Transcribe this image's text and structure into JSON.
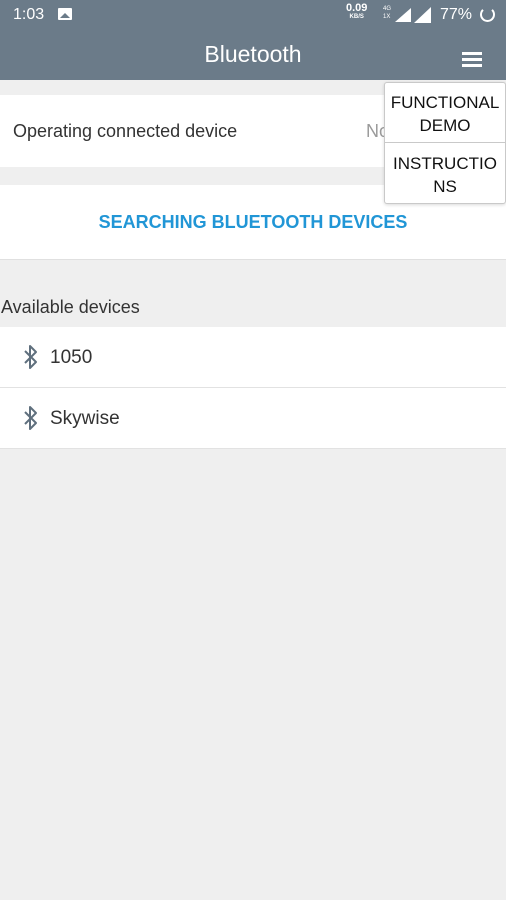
{
  "status_bar": {
    "time": "1:03",
    "net_speed": "0.09",
    "net_speed_unit": "KB/S",
    "network_label_top": "4G",
    "network_label_bottom": "1X",
    "battery": "77%"
  },
  "app_bar": {
    "title": "Bluetooth"
  },
  "connected": {
    "label": "Operating connected device",
    "value": "No"
  },
  "search_button": "SEARCHING BLUETOOTH DEVICES",
  "available": {
    "header": "Available devices",
    "devices": [
      {
        "name": "1050"
      },
      {
        "name": "Skywise"
      }
    ]
  },
  "menu": {
    "items": [
      {
        "line1": "FUNCTIONAL",
        "line2": "DEMO"
      },
      {
        "line1": "INSTRUCTIO",
        "line2": "NS"
      }
    ]
  },
  "colors": {
    "app_bar": "#6b7b89",
    "accent": "#2196d6",
    "background": "#efefef"
  },
  "icons": [
    "image-icon",
    "signal-icon",
    "battery-ring-icon",
    "menu-icon",
    "bluetooth-icon"
  ]
}
